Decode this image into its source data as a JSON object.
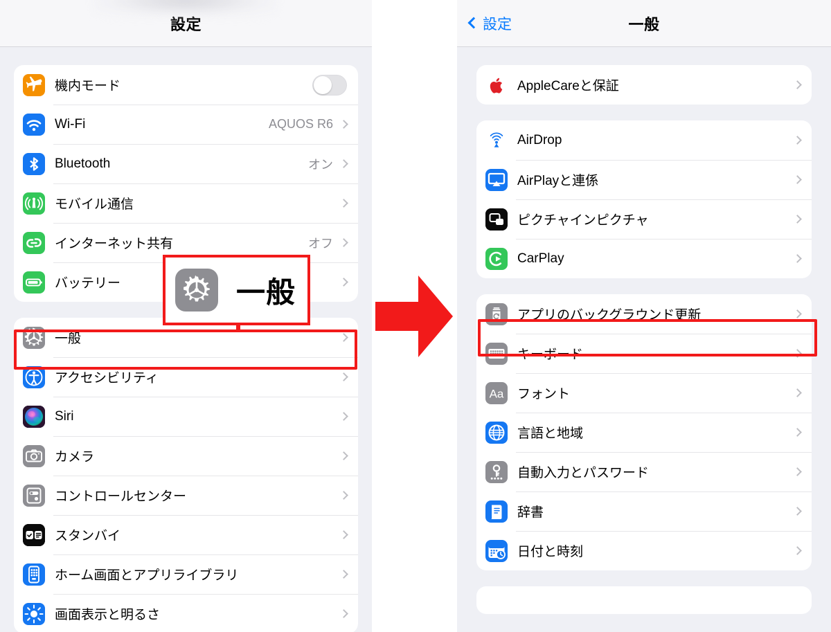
{
  "left_phone": {
    "nav": {
      "title": "設定"
    },
    "groups": [
      {
        "name": "connectivity-group",
        "rows": [
          {
            "label": "機内モード",
            "icon": "airplane-icon",
            "icon_color": "#f59000",
            "accessory": "toggle",
            "toggle_on": false,
            "value": ""
          },
          {
            "label": "Wi-Fi",
            "icon": "wifi-icon",
            "icon_color": "#1577f2",
            "accessory": "chevron",
            "value": "AQUOS R6"
          },
          {
            "label": "Bluetooth",
            "icon": "bluetooth-icon",
            "icon_color": "#1577f2",
            "accessory": "chevron",
            "value": "オン"
          },
          {
            "label": "モバイル通信",
            "icon": "cellular-icon",
            "icon_color": "#34c759",
            "accessory": "chevron",
            "value": ""
          },
          {
            "label": "インターネット共有",
            "icon": "hotspot-link-icon",
            "icon_color": "#34c759",
            "accessory": "chevron",
            "value": "オフ"
          },
          {
            "label": "バッテリー",
            "icon": "battery-icon",
            "icon_color": "#34c759",
            "accessory": "chevron",
            "value": ""
          }
        ]
      },
      {
        "name": "system-group",
        "rows": [
          {
            "label": "一般",
            "icon": "gear-icon",
            "icon_color": "#8e8e93",
            "accessory": "chevron",
            "value": ""
          },
          {
            "label": "アクセシビリティ",
            "icon": "accessibility-icon",
            "icon_color": "#1577f2",
            "accessory": "chevron",
            "value": ""
          },
          {
            "label": "Siri",
            "icon": "siri-icon",
            "icon_color": "#2b1b3a",
            "accessory": "chevron",
            "value": ""
          },
          {
            "label": "カメラ",
            "icon": "camera-icon",
            "icon_color": "#8e8e93",
            "accessory": "chevron",
            "value": ""
          },
          {
            "label": "コントロールセンター",
            "icon": "control-center-icon",
            "icon_color": "#8e8e93",
            "accessory": "chevron",
            "value": ""
          },
          {
            "label": "スタンバイ",
            "icon": "standby-icon",
            "icon_color": "#0a0a0a",
            "accessory": "chevron",
            "value": ""
          },
          {
            "label": "ホーム画面とアプリライブラリ",
            "icon": "home-screen-icon",
            "icon_color": "#1577f2",
            "accessory": "chevron",
            "value": ""
          },
          {
            "label": "画面表示と明るさ",
            "icon": "brightness-icon",
            "icon_color": "#1577f2",
            "accessory": "chevron",
            "value": ""
          }
        ]
      }
    ]
  },
  "right_phone": {
    "nav": {
      "back_label": "設定",
      "title": "一般"
    },
    "groups": [
      {
        "name": "applecare-group",
        "rows": [
          {
            "label": "AppleCareと保証",
            "icon": "apple-logo-icon",
            "icon_color": "#ffffff",
            "accessory": "chevron",
            "value": ""
          }
        ]
      },
      {
        "name": "media-group",
        "rows": [
          {
            "label": "AirDrop",
            "icon": "airdrop-icon",
            "icon_color": "#ffffff",
            "accessory": "chevron",
            "value": ""
          },
          {
            "label": "AirPlayと連係",
            "icon": "airplay-icon",
            "icon_color": "#1577f2",
            "accessory": "chevron",
            "value": ""
          },
          {
            "label": "ピクチャインピクチャ",
            "icon": "picture-in-picture-icon",
            "icon_color": "#0a0a0a",
            "accessory": "chevron",
            "value": ""
          },
          {
            "label": "CarPlay",
            "icon": "carplay-icon",
            "icon_color": "#34c759",
            "accessory": "chevron",
            "value": ""
          }
        ]
      },
      {
        "name": "input-group",
        "rows": [
          {
            "label": "アプリのバックグラウンド更新",
            "icon": "background-refresh-icon",
            "icon_color": "#8e8e93",
            "accessory": "chevron",
            "value": ""
          },
          {
            "label": "キーボード",
            "icon": "keyboard-icon",
            "icon_color": "#8e8e93",
            "accessory": "chevron",
            "value": ""
          },
          {
            "label": "フォント",
            "icon": "font-icon",
            "icon_color": "#8e8e93",
            "accessory": "chevron",
            "value": ""
          },
          {
            "label": "言語と地域",
            "icon": "globe-icon",
            "icon_color": "#1577f2",
            "accessory": "chevron",
            "value": ""
          },
          {
            "label": "自動入力とパスワード",
            "icon": "key-password-icon",
            "icon_color": "#8e8e93",
            "accessory": "chevron",
            "value": ""
          },
          {
            "label": "辞書",
            "icon": "dictionary-icon",
            "icon_color": "#1577f2",
            "accessory": "chevron",
            "value": ""
          },
          {
            "label": "日付と時刻",
            "icon": "date-time-icon",
            "icon_color": "#1577f2",
            "accessory": "chevron",
            "value": ""
          }
        ]
      }
    ]
  },
  "annotations": {
    "highlight_color": "#f21a1a",
    "arrow": {
      "name": "red-right-arrow",
      "direction": "right",
      "color": "#f21a1a"
    },
    "callout": {
      "name": "general-row-magnified-callout",
      "label": "一般",
      "icon": "gear-icon",
      "icon_color": "#8e8e93"
    },
    "highlighted_rows": [
      "一般",
      "アプリのバックグラウンド更新"
    ]
  }
}
